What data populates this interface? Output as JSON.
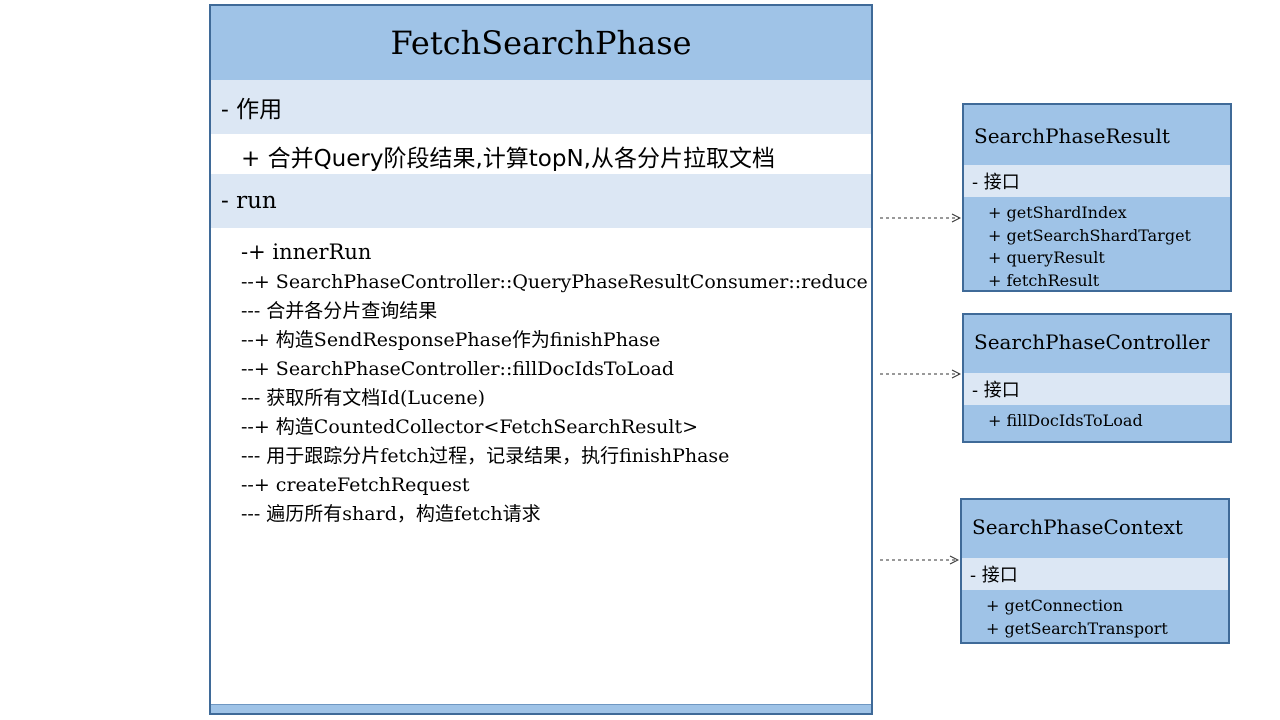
{
  "main_class": {
    "title": "FetchSearchPhase",
    "purpose_header": "- 作用",
    "purpose_line": "+ 合并Query阶段结果,计算topN,从各分片拉取文档",
    "run_header": "- run",
    "run_lines": [
      "-+ innerRun",
      "--+ SearchPhaseController::QueryPhaseResultConsumer::reduce",
      "--- 合并各分片查询结果",
      "--+ 构造SendResponsePhase作为finishPhase",
      "--+ SearchPhaseController::fillDocIdsToLoad",
      "--- 获取所有文档Id(Lucene)",
      "--+ 构造CountedCollector<FetchSearchResult>",
      "--- 用于跟踪分片fetch过程，记录结果，执行finishPhase",
      "--+ createFetchRequest",
      "--- 遍历所有shard，构造fetch请求"
    ]
  },
  "interfaces": [
    {
      "title": "SearchPhaseResult",
      "section": "- 接口",
      "methods": [
        "+ getShardIndex",
        "+ getSearchShardTarget",
        "+ queryResult",
        "+ fetchResult"
      ]
    },
    {
      "title": "SearchPhaseController",
      "section": "- 接口",
      "methods": [
        "+ fillDocIdsToLoad"
      ]
    },
    {
      "title": "SearchPhaseContext",
      "section": "- 接口",
      "methods": [
        "+ getConnection",
        "+ getSearchTransport"
      ]
    }
  ],
  "colors": {
    "header_fill": "#9fc3e7",
    "section_fill": "#dce7f4",
    "border": "#3f6a98",
    "connector": "#333333"
  }
}
